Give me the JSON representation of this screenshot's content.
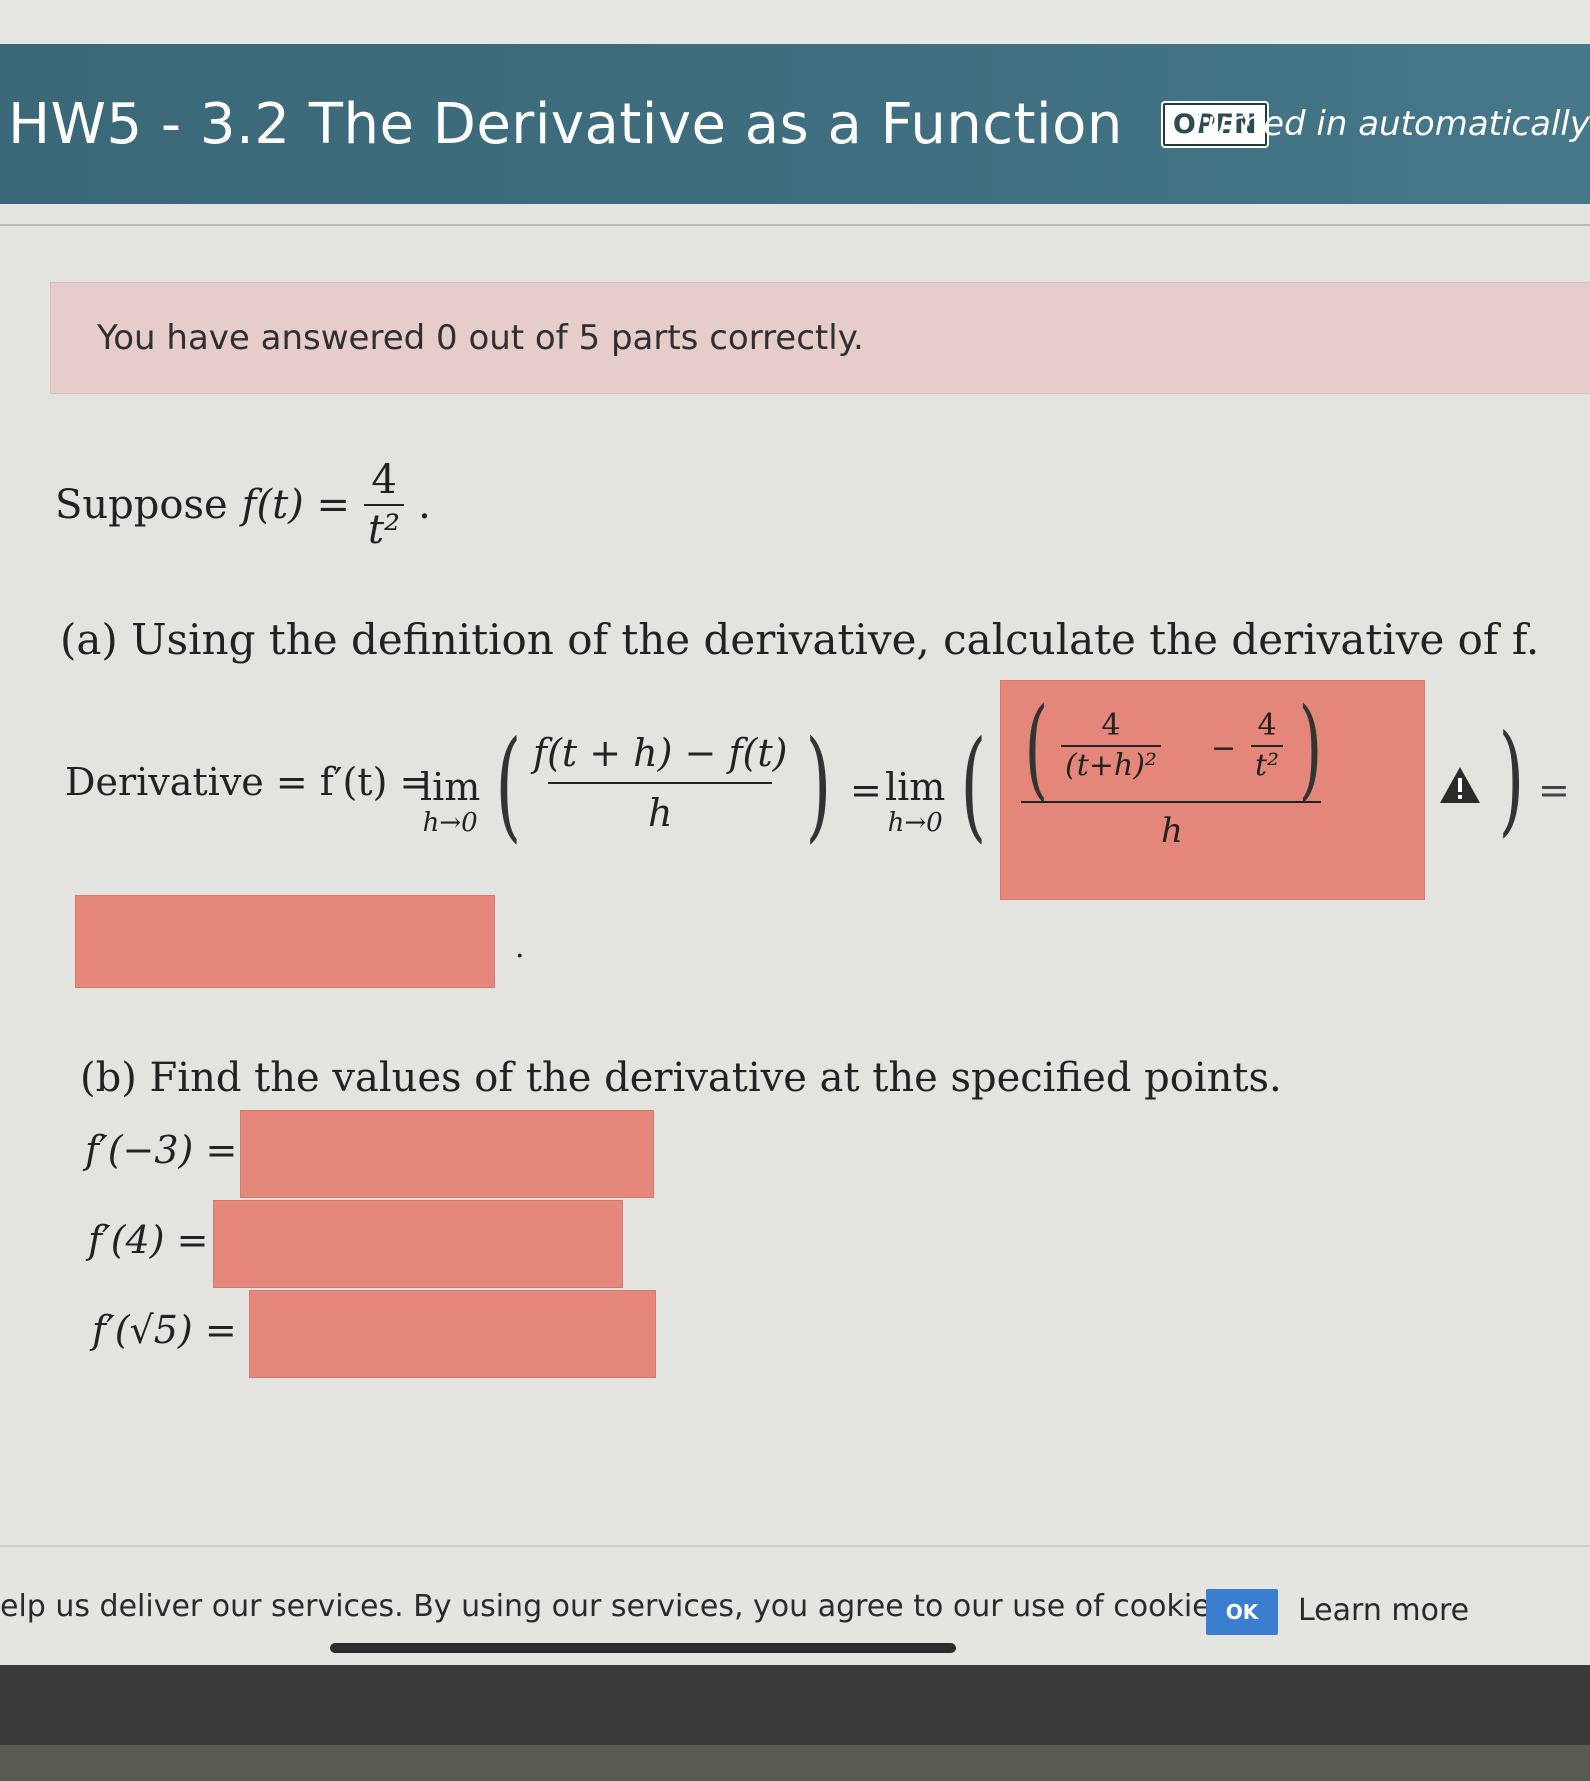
{
  "header": {
    "title": "HW5 - 3.2 The Derivative as a Function",
    "status_badge": "OPEN",
    "turned_in": "Turned in automatically"
  },
  "alert": {
    "text": "You have answered 0 out of 5 parts correctly."
  },
  "problem": {
    "suppose_word": "Suppose",
    "fx": "f(t) =",
    "fx_num": "4",
    "fx_den": "t²",
    "period": "."
  },
  "part_a": {
    "prompt": "(a) Using the definition of the derivative, calculate the derivative of f.",
    "derivative_label": "Derivative = f′(t) =",
    "lim": "lim",
    "lim_sub": "h→0",
    "dq_num": "f(t + h) − f(t)",
    "dq_den": "h",
    "eq": "=",
    "answer_num_a_top": "4",
    "answer_num_a_bot": "(t+h)²",
    "answer_minus": "−",
    "answer_num_b_top": "4",
    "answer_num_b_bot": "t²",
    "answer_den": "h",
    "trailing_eq": "=",
    "final_period": "."
  },
  "part_b": {
    "prompt": "(b) Find the values of the derivative at the specified points.",
    "rows": [
      {
        "label": "f′(−3) ="
      },
      {
        "label": "f′(4) ="
      },
      {
        "label": "f′(√5) ="
      }
    ]
  },
  "cookie": {
    "message": "elp us deliver our services. By using our services, you agree to our use of cookies.",
    "ok": "OK",
    "learn_more": "Learn more"
  },
  "colors": {
    "header_bg": "#3f6f80",
    "alert_bg": "#e6cccb",
    "incorrect_box": "#e5887b",
    "ok_button": "#3b7ed0"
  }
}
